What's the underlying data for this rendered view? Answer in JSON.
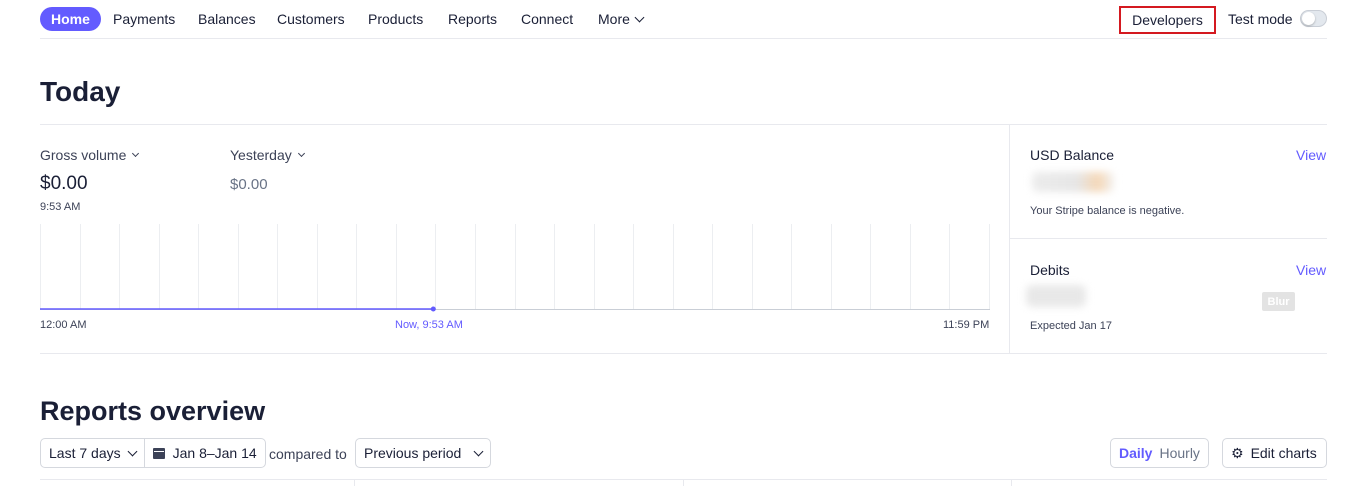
{
  "nav": {
    "items": [
      "Home",
      "Payments",
      "Balances",
      "Customers",
      "Products",
      "Reports",
      "Connect"
    ],
    "more_label": "More",
    "developers_label": "Developers",
    "test_mode_label": "Test mode"
  },
  "today": {
    "title": "Today",
    "gross_volume": {
      "label": "Gross volume",
      "value": "$0.00",
      "time": "9:53 AM"
    },
    "yesterday": {
      "label": "Yesterday",
      "value": "$0.00"
    },
    "chart": {
      "start_label": "12:00 AM",
      "now_label": "Now, 9:53 AM",
      "end_label": "11:59 PM",
      "now_fraction": 0.414,
      "value": 0,
      "line_color": "#635bff"
    }
  },
  "usd_balance": {
    "title": "USD Balance",
    "view_label": "View",
    "note": "Your Stripe balance is negative."
  },
  "debits": {
    "title": "Debits",
    "view_label": "View",
    "note": "Expected Jan 17",
    "blur_tag": "Blur"
  },
  "reports": {
    "title": "Reports overview",
    "range_label": "Last 7 days",
    "date_range": "Jan 8–Jan 14",
    "compared_label": "compared to",
    "period_label": "Previous period",
    "daily_label": "Daily",
    "hourly_label": "Hourly",
    "edit_label": "Edit charts"
  },
  "colors": {
    "accent": "#635bff",
    "highlight_border": "#d41920"
  }
}
